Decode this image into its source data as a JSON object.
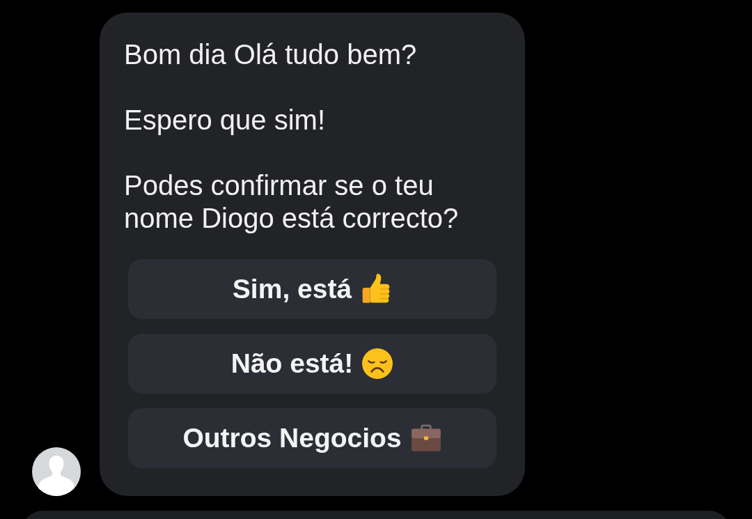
{
  "message": {
    "paragraphs": [
      "Bom dia Olá tudo bem?",
      "Espero que sim!",
      "Podes confirmar se o teu nome Diogo está correcto?"
    ]
  },
  "quick_replies": [
    {
      "label": "Sim, está",
      "kind": "thumbsup"
    },
    {
      "label": "Não está!",
      "kind": "sad"
    },
    {
      "label": "Outros Negocios",
      "kind": "briefcase"
    }
  ]
}
